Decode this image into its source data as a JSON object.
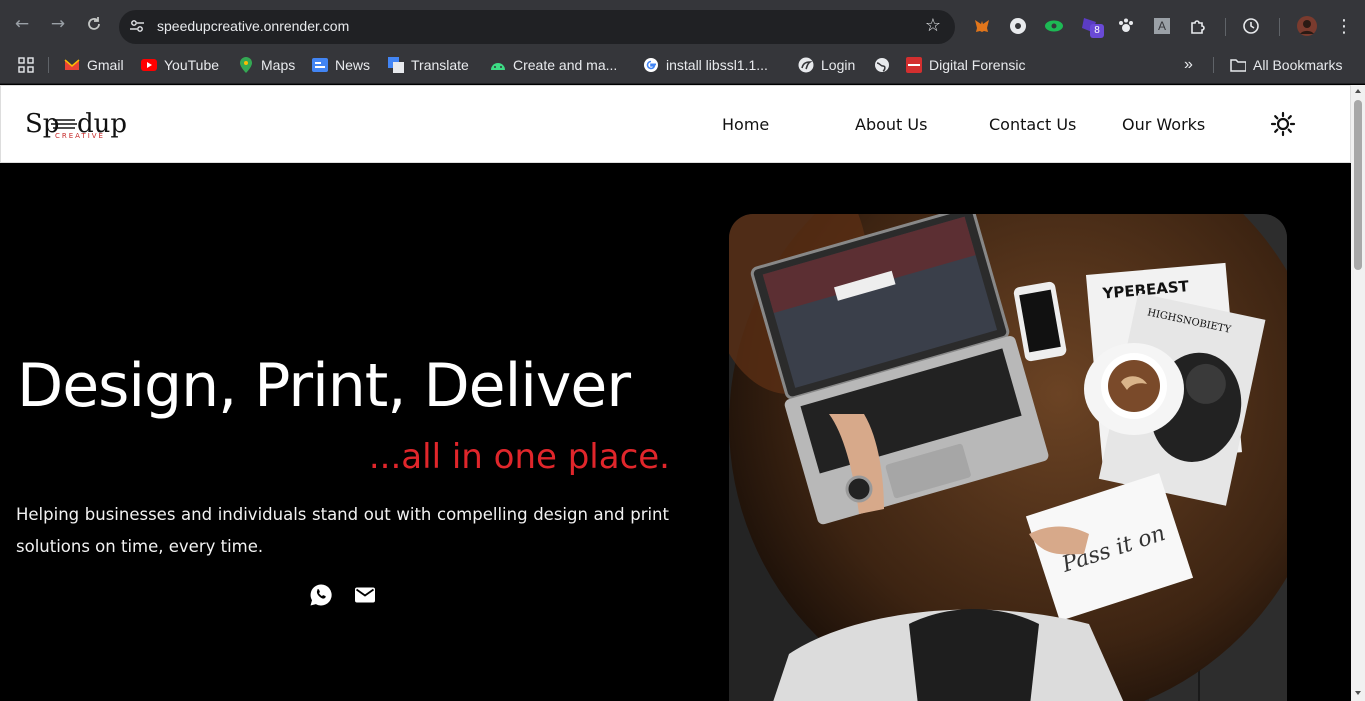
{
  "browser": {
    "url": "speedupcreative.onrender.com",
    "extension_badge": "8",
    "bookmarks": [
      {
        "label": "Gmail",
        "icon": "gmail-icon"
      },
      {
        "label": "YouTube",
        "icon": "youtube-icon"
      },
      {
        "label": "Maps",
        "icon": "maps-icon"
      },
      {
        "label": "News",
        "icon": "news-icon"
      },
      {
        "label": "Translate",
        "icon": "translate-icon"
      },
      {
        "label": "Create and ma...",
        "icon": "android-icon"
      },
      {
        "label": "install libssl1.1...",
        "icon": "google-icon"
      },
      {
        "label": "Login",
        "icon": "login-icon"
      },
      {
        "label": "",
        "icon": "globe-icon"
      },
      {
        "label": "Digital Forensic",
        "icon": "forensic-icon"
      }
    ],
    "all_bookmarks_label": "All Bookmarks"
  },
  "site": {
    "logo": {
      "main": "Sp=dup",
      "sub": "CREATIVE"
    },
    "nav": [
      {
        "label": "Home"
      },
      {
        "label": "About Us"
      },
      {
        "label": "Contact Us"
      },
      {
        "label": "Our Works"
      }
    ],
    "hero": {
      "title": "Design, Print, Deliver",
      "tagline": "...all in one place.",
      "description": "Helping businesses and individuals stand out with compelling design and print solutions on time, every time."
    },
    "colors": {
      "accent": "#e0262b",
      "background": "#000000",
      "nav_background": "#ffffff"
    }
  }
}
